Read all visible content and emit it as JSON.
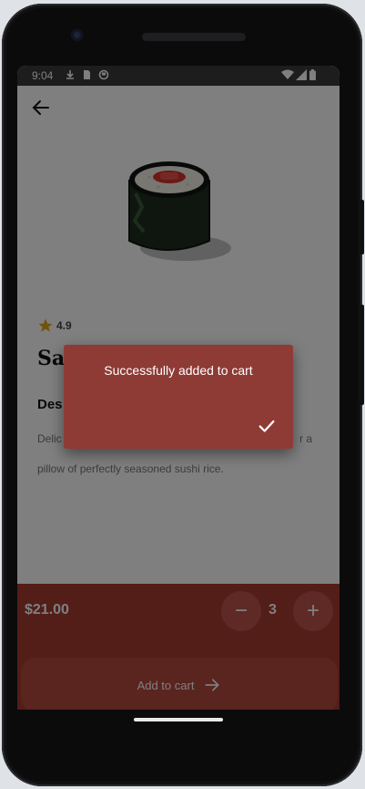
{
  "status_bar": {
    "time": "9:04"
  },
  "product": {
    "rating": "4.9",
    "name_visible": "Sa",
    "description_heading_visible": "Des",
    "description_line1_visible": "Delic",
    "description_line1_end": "r a",
    "description_line2": "pillow of perfectly seasoned sushi rice."
  },
  "cart": {
    "price": "$21.00",
    "quantity": "3",
    "minus_symbol": "−",
    "plus_symbol": "+",
    "add_label": "Add to cart"
  },
  "dialog": {
    "message": "Successfully added to cart"
  },
  "icons": {
    "back": "arrow-left-icon",
    "star": "star-icon",
    "check": "check-icon",
    "arrow": "arrow-right-icon"
  },
  "colors": {
    "accent": "#a63a31",
    "dialog": "#8e3b36",
    "star": "#e0a61a"
  }
}
